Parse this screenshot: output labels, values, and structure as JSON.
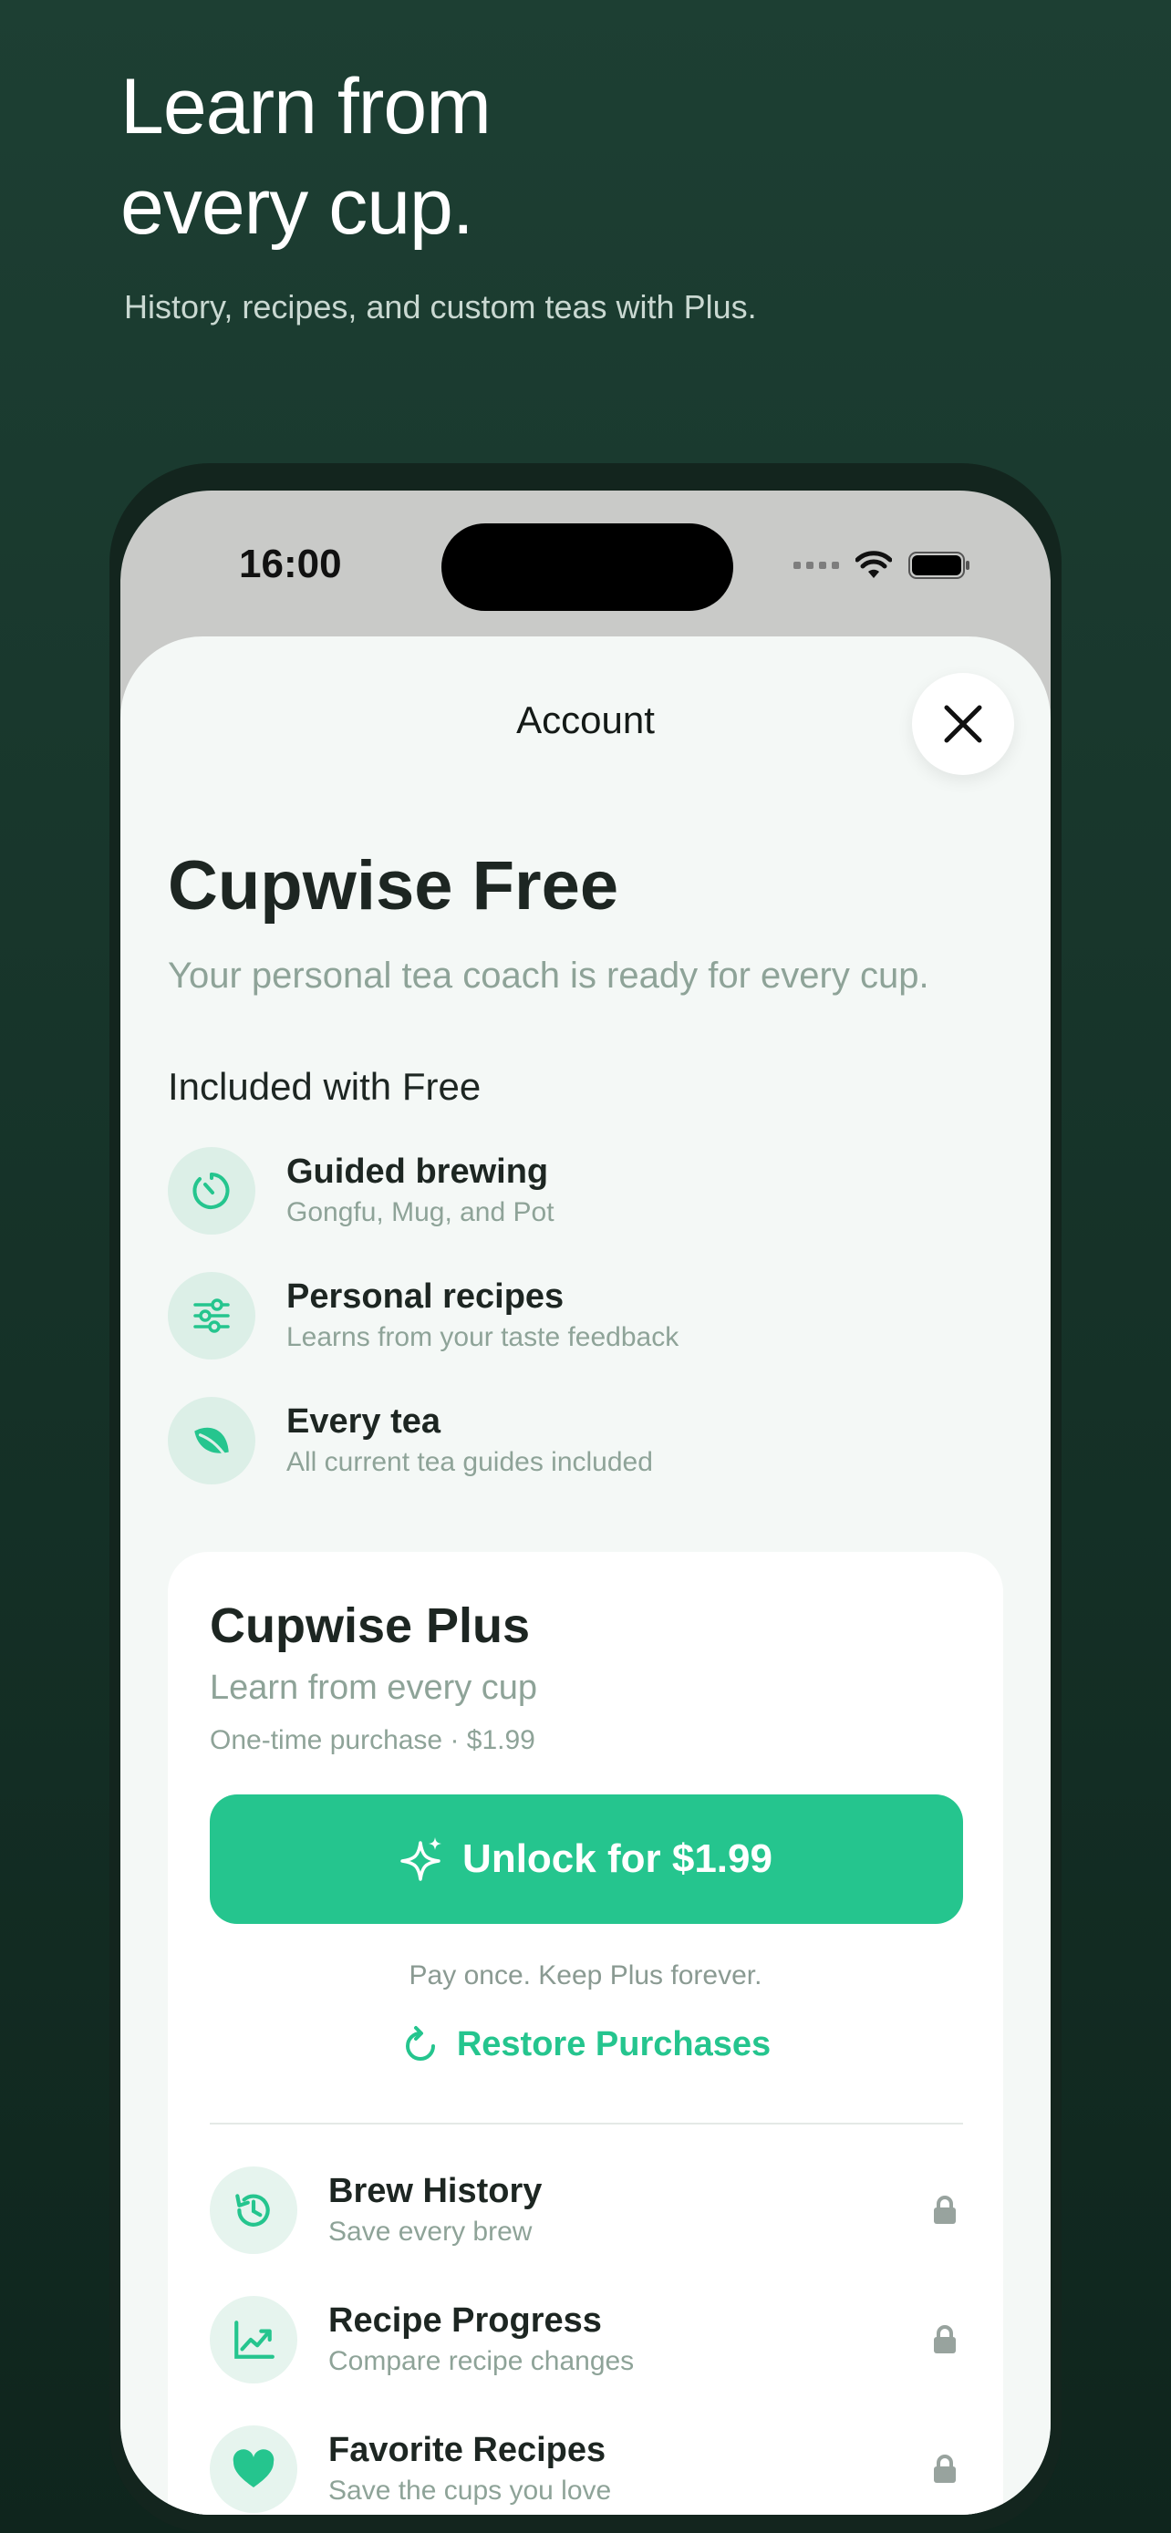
{
  "promo": {
    "headline_line1": "Learn from",
    "headline_line2": "every cup.",
    "subhead": "History, recipes, and custom teas with Plus."
  },
  "status_bar": {
    "time": "16:00",
    "icons": [
      "signal-icon",
      "wifi-icon",
      "battery-icon"
    ]
  },
  "sheet": {
    "title": "Account",
    "close_icon": "close-icon",
    "plan_title": "Cupwise Free",
    "plan_subtitle": "Your personal tea coach is ready for every cup.",
    "included_label": "Included with Free",
    "features": [
      {
        "icon": "timer-icon",
        "title": "Guided brewing",
        "subtitle": "Gongfu, Mug, and Pot"
      },
      {
        "icon": "sliders-icon",
        "title": "Personal recipes",
        "subtitle": "Learns from your taste feedback"
      },
      {
        "icon": "leaf-icon",
        "title": "Every tea",
        "subtitle": "All current tea guides included"
      }
    ]
  },
  "plus": {
    "title": "Cupwise Plus",
    "subtitle": "Learn from every cup",
    "price_line": "One-time purchase · $1.99",
    "unlock_label": "Unlock for $1.99",
    "pay_once": "Pay once. Keep Plus forever.",
    "restore_label": "Restore Purchases",
    "locked_features": [
      {
        "icon": "history-icon",
        "title": "Brew History",
        "subtitle": "Save every brew"
      },
      {
        "icon": "chart-icon",
        "title": "Recipe Progress",
        "subtitle": "Compare recipe changes"
      },
      {
        "icon": "heart-icon",
        "title": "Favorite Recipes",
        "subtitle": "Save the cups you love"
      }
    ]
  },
  "colors": {
    "background": "#1a3a2e",
    "accent": "#25c58e",
    "text_primary": "#1d2622",
    "text_secondary": "#8ea398"
  }
}
